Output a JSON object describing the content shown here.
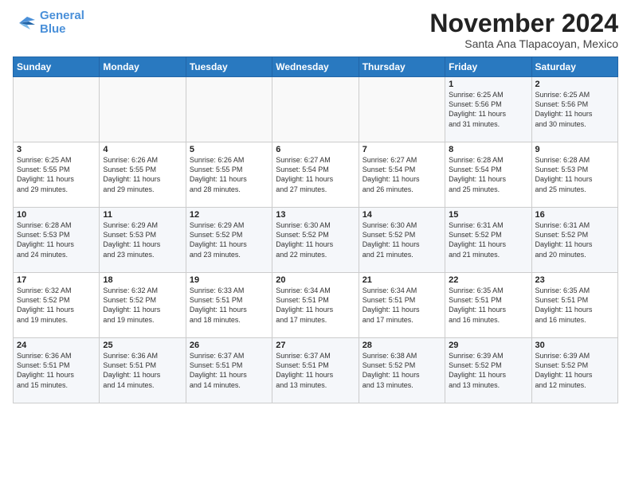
{
  "logo": {
    "line1": "General",
    "line2": "Blue"
  },
  "title": "November 2024",
  "location": "Santa Ana Tlapacoyan, Mexico",
  "days_header": [
    "Sunday",
    "Monday",
    "Tuesday",
    "Wednesday",
    "Thursday",
    "Friday",
    "Saturday"
  ],
  "weeks": [
    [
      {
        "day": "",
        "info": ""
      },
      {
        "day": "",
        "info": ""
      },
      {
        "day": "",
        "info": ""
      },
      {
        "day": "",
        "info": ""
      },
      {
        "day": "",
        "info": ""
      },
      {
        "day": "1",
        "info": "Sunrise: 6:25 AM\nSunset: 5:56 PM\nDaylight: 11 hours\nand 31 minutes."
      },
      {
        "day": "2",
        "info": "Sunrise: 6:25 AM\nSunset: 5:56 PM\nDaylight: 11 hours\nand 30 minutes."
      }
    ],
    [
      {
        "day": "3",
        "info": "Sunrise: 6:25 AM\nSunset: 5:55 PM\nDaylight: 11 hours\nand 29 minutes."
      },
      {
        "day": "4",
        "info": "Sunrise: 6:26 AM\nSunset: 5:55 PM\nDaylight: 11 hours\nand 29 minutes."
      },
      {
        "day": "5",
        "info": "Sunrise: 6:26 AM\nSunset: 5:55 PM\nDaylight: 11 hours\nand 28 minutes."
      },
      {
        "day": "6",
        "info": "Sunrise: 6:27 AM\nSunset: 5:54 PM\nDaylight: 11 hours\nand 27 minutes."
      },
      {
        "day": "7",
        "info": "Sunrise: 6:27 AM\nSunset: 5:54 PM\nDaylight: 11 hours\nand 26 minutes."
      },
      {
        "day": "8",
        "info": "Sunrise: 6:28 AM\nSunset: 5:54 PM\nDaylight: 11 hours\nand 25 minutes."
      },
      {
        "day": "9",
        "info": "Sunrise: 6:28 AM\nSunset: 5:53 PM\nDaylight: 11 hours\nand 25 minutes."
      }
    ],
    [
      {
        "day": "10",
        "info": "Sunrise: 6:28 AM\nSunset: 5:53 PM\nDaylight: 11 hours\nand 24 minutes."
      },
      {
        "day": "11",
        "info": "Sunrise: 6:29 AM\nSunset: 5:53 PM\nDaylight: 11 hours\nand 23 minutes."
      },
      {
        "day": "12",
        "info": "Sunrise: 6:29 AM\nSunset: 5:52 PM\nDaylight: 11 hours\nand 23 minutes."
      },
      {
        "day": "13",
        "info": "Sunrise: 6:30 AM\nSunset: 5:52 PM\nDaylight: 11 hours\nand 22 minutes."
      },
      {
        "day": "14",
        "info": "Sunrise: 6:30 AM\nSunset: 5:52 PM\nDaylight: 11 hours\nand 21 minutes."
      },
      {
        "day": "15",
        "info": "Sunrise: 6:31 AM\nSunset: 5:52 PM\nDaylight: 11 hours\nand 21 minutes."
      },
      {
        "day": "16",
        "info": "Sunrise: 6:31 AM\nSunset: 5:52 PM\nDaylight: 11 hours\nand 20 minutes."
      }
    ],
    [
      {
        "day": "17",
        "info": "Sunrise: 6:32 AM\nSunset: 5:52 PM\nDaylight: 11 hours\nand 19 minutes."
      },
      {
        "day": "18",
        "info": "Sunrise: 6:32 AM\nSunset: 5:52 PM\nDaylight: 11 hours\nand 19 minutes."
      },
      {
        "day": "19",
        "info": "Sunrise: 6:33 AM\nSunset: 5:51 PM\nDaylight: 11 hours\nand 18 minutes."
      },
      {
        "day": "20",
        "info": "Sunrise: 6:34 AM\nSunset: 5:51 PM\nDaylight: 11 hours\nand 17 minutes."
      },
      {
        "day": "21",
        "info": "Sunrise: 6:34 AM\nSunset: 5:51 PM\nDaylight: 11 hours\nand 17 minutes."
      },
      {
        "day": "22",
        "info": "Sunrise: 6:35 AM\nSunset: 5:51 PM\nDaylight: 11 hours\nand 16 minutes."
      },
      {
        "day": "23",
        "info": "Sunrise: 6:35 AM\nSunset: 5:51 PM\nDaylight: 11 hours\nand 16 minutes."
      }
    ],
    [
      {
        "day": "24",
        "info": "Sunrise: 6:36 AM\nSunset: 5:51 PM\nDaylight: 11 hours\nand 15 minutes."
      },
      {
        "day": "25",
        "info": "Sunrise: 6:36 AM\nSunset: 5:51 PM\nDaylight: 11 hours\nand 14 minutes."
      },
      {
        "day": "26",
        "info": "Sunrise: 6:37 AM\nSunset: 5:51 PM\nDaylight: 11 hours\nand 14 minutes."
      },
      {
        "day": "27",
        "info": "Sunrise: 6:37 AM\nSunset: 5:51 PM\nDaylight: 11 hours\nand 13 minutes."
      },
      {
        "day": "28",
        "info": "Sunrise: 6:38 AM\nSunset: 5:52 PM\nDaylight: 11 hours\nand 13 minutes."
      },
      {
        "day": "29",
        "info": "Sunrise: 6:39 AM\nSunset: 5:52 PM\nDaylight: 11 hours\nand 13 minutes."
      },
      {
        "day": "30",
        "info": "Sunrise: 6:39 AM\nSunset: 5:52 PM\nDaylight: 11 hours\nand 12 minutes."
      }
    ]
  ]
}
